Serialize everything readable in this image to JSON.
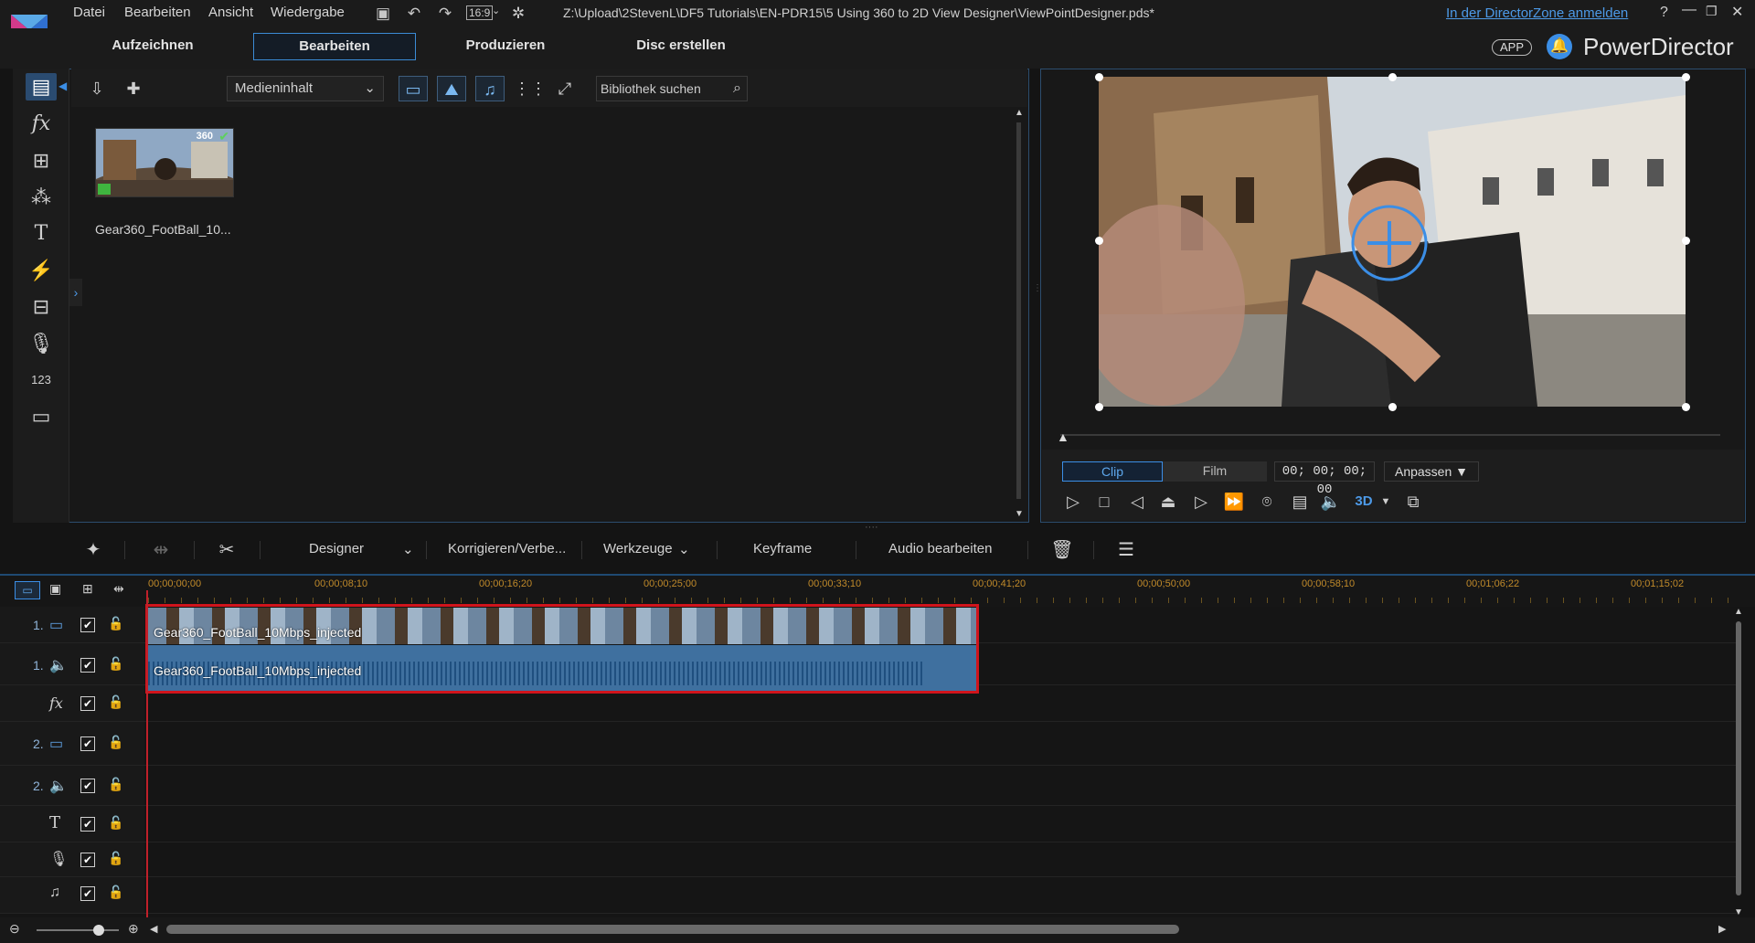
{
  "menu": {
    "items": [
      "Datei",
      "Bearbeiten",
      "Ansicht",
      "Wiedergabe"
    ],
    "aspect": "16:9",
    "file_path": "Z:\\Upload\\2StevenL\\DF5 Tutorials\\EN-PDR15\\5 Using 360 to 2D View Designer\\ViewPointDesigner.pds*",
    "login_link": "In der DirectorZone anmelden",
    "help": "?"
  },
  "modes": {
    "tabs": [
      "Aufzeichnen",
      "Bearbeiten",
      "Produzieren",
      "Disc erstellen"
    ],
    "active": "Bearbeiten"
  },
  "brand": {
    "app_badge": "APP",
    "name": "PowerDirector"
  },
  "library": {
    "dropdown": "Medieninhalt",
    "search_placeholder": "Bibliothek suchen",
    "media": [
      {
        "label": "Gear360_FootBall_10...",
        "badge": "360"
      }
    ]
  },
  "preview": {
    "clip_label": "Clip",
    "film_label": "Film",
    "timecode": "00; 00; 00; 00",
    "fit_label": "Anpassen",
    "three_d": "3D"
  },
  "edit_toolbar": {
    "designer": "Designer",
    "korrigieren": "Korrigieren/Verbe...",
    "werkzeuge": "Werkzeuge",
    "keyframe": "Keyframe",
    "audio": "Audio bearbeiten"
  },
  "ruler": [
    "00;00;00;00",
    "00;00;08;10",
    "00;00;16;20",
    "00;00;25;00",
    "00;00;33;10",
    "00;00;41;20",
    "00;00;50;00",
    "00;00;58;10",
    "00;01;06;22",
    "00;01;15;02"
  ],
  "tracks": [
    {
      "num": "1.",
      "icon": "video"
    },
    {
      "num": "1.",
      "icon": "audio"
    },
    {
      "num": "",
      "icon": "fx"
    },
    {
      "num": "2.",
      "icon": "video"
    },
    {
      "num": "2.",
      "icon": "audio"
    },
    {
      "num": "",
      "icon": "title"
    },
    {
      "num": "",
      "icon": "voice"
    },
    {
      "num": "",
      "icon": "music"
    }
  ],
  "clips": {
    "video_name": "Gear360_FootBall_10Mbps_injected",
    "audio_name": "Gear360_FootBall_10Mbps_injected"
  }
}
